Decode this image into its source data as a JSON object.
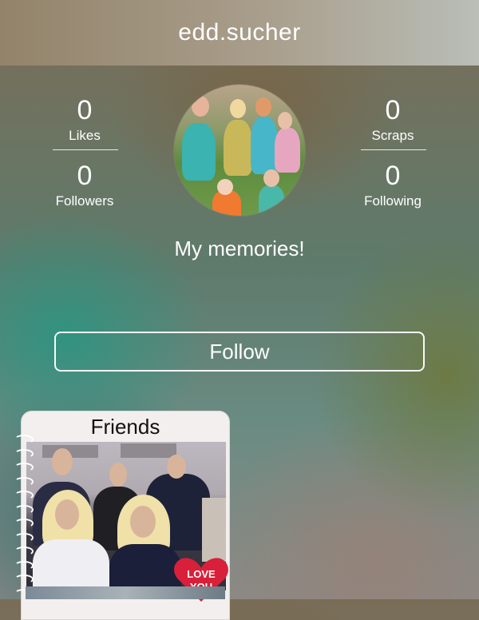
{
  "header": {
    "title": "edd.sucher"
  },
  "stats": {
    "likes": {
      "value": "0",
      "label": "Likes"
    },
    "followers": {
      "value": "0",
      "label": "Followers"
    },
    "scraps": {
      "value": "0",
      "label": "Scraps"
    },
    "following": {
      "value": "0",
      "label": "Following"
    }
  },
  "profile": {
    "bio": "My memories!"
  },
  "actions": {
    "follow_label": "Follow"
  },
  "scraps_list": [
    {
      "title": "Friends",
      "sticker_text": "LOVE YOU"
    }
  ],
  "colors": {
    "text": "#ffffff",
    "sticker": "#d8203a"
  }
}
